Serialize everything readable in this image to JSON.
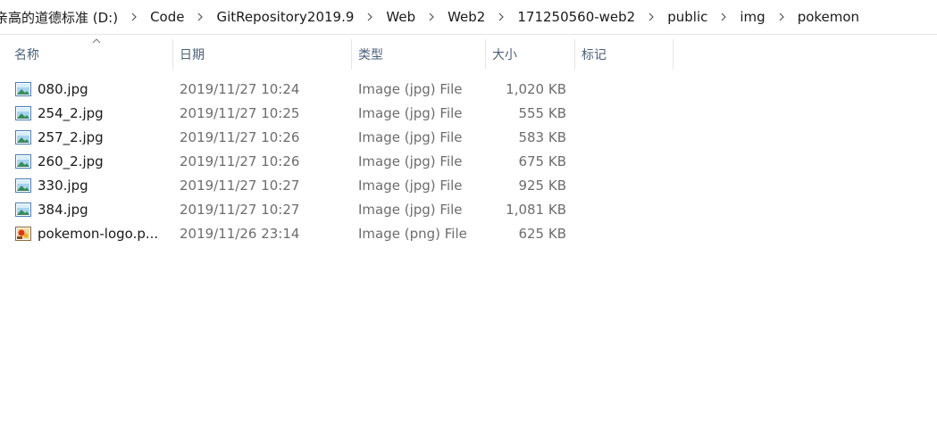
{
  "breadcrumb": {
    "items": [
      "亲高的道德标准 (D:)",
      "Code",
      "GitRepository2019.9",
      "Web",
      "Web2",
      "171250560-web2",
      "public",
      "img",
      "pokemon"
    ]
  },
  "columns": {
    "name": "名称",
    "date": "日期",
    "type": "类型",
    "size": "大小",
    "tags": "标记"
  },
  "files": [
    {
      "name": "080.jpg",
      "date": "2019/11/27 10:24",
      "type": "Image (jpg) File",
      "size": "1,020 KB",
      "icon": "jpg-image-icon"
    },
    {
      "name": "254_2.jpg",
      "date": "2019/11/27 10:25",
      "type": "Image (jpg) File",
      "size": "555 KB",
      "icon": "jpg-image-icon"
    },
    {
      "name": "257_2.jpg",
      "date": "2019/11/27 10:26",
      "type": "Image (jpg) File",
      "size": "583 KB",
      "icon": "jpg-image-icon"
    },
    {
      "name": "260_2.jpg",
      "date": "2019/11/27 10:26",
      "type": "Image (jpg) File",
      "size": "675 KB",
      "icon": "jpg-image-icon"
    },
    {
      "name": "330.jpg",
      "date": "2019/11/27 10:27",
      "type": "Image (jpg) File",
      "size": "925 KB",
      "icon": "jpg-image-icon"
    },
    {
      "name": "384.jpg",
      "date": "2019/11/27 10:27",
      "type": "Image (jpg) File",
      "size": "1,081 KB",
      "icon": "jpg-image-icon"
    },
    {
      "name": "pokemon-logo.p...",
      "date": "2019/11/26 23:14",
      "type": "Image (png) File",
      "size": "625 KB",
      "icon": "png-image-icon"
    }
  ]
}
